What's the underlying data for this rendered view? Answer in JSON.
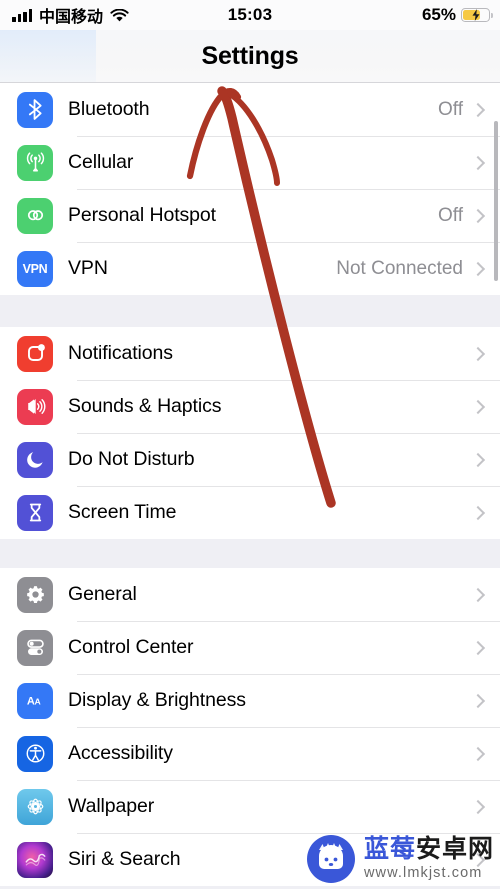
{
  "status_bar": {
    "carrier": "中国移动",
    "time": "15:03",
    "battery_percent": "65%",
    "battery_level": 65,
    "signal_icon": "cellular-signal-icon",
    "wifi_icon": "wifi-icon",
    "battery_icon": "battery-charging-icon"
  },
  "navbar": {
    "title": "Settings"
  },
  "groups": [
    {
      "id": "connectivity",
      "rows": [
        {
          "label": "Bluetooth",
          "value": "Off",
          "icon": "bluetooth-icon",
          "icon_bg": "#3478f6"
        },
        {
          "label": "Cellular",
          "value": "",
          "icon": "cellular-icon",
          "icon_bg": "#4cd070"
        },
        {
          "label": "Personal Hotspot",
          "value": "Off",
          "icon": "personal-hotspot-icon",
          "icon_bg": "#4cd070"
        },
        {
          "label": "VPN",
          "value": "Not Connected",
          "icon": "vpn-icon",
          "icon_bg": "#3478f6"
        }
      ]
    },
    {
      "id": "alerts",
      "rows": [
        {
          "label": "Notifications",
          "value": "",
          "icon": "notifications-icon",
          "icon_bg": "#f03e2f"
        },
        {
          "label": "Sounds & Haptics",
          "value": "",
          "icon": "sounds-haptics-icon",
          "icon_bg": "#ec3css"
        },
        {
          "label": "Do Not Disturb",
          "value": "",
          "icon": "do-not-disturb-icon",
          "icon_bg": "#5251d6"
        },
        {
          "label": "Screen Time",
          "value": "",
          "icon": "screen-time-icon",
          "icon_bg": "#5251d6"
        }
      ]
    },
    {
      "id": "system",
      "rows": [
        {
          "label": "General",
          "value": "",
          "icon": "general-gear-icon",
          "icon_bg": "#8e8e93"
        },
        {
          "label": "Control Center",
          "value": "",
          "icon": "control-center-icon",
          "icon_bg": "#8e8e93"
        },
        {
          "label": "Display & Brightness",
          "value": "",
          "icon": "display-brightness-icon",
          "icon_bg": "#3478f6"
        },
        {
          "label": "Accessibility",
          "value": "",
          "icon": "accessibility-icon",
          "icon_bg": "#1665e3"
        },
        {
          "label": "Wallpaper",
          "value": "",
          "icon": "wallpaper-icon",
          "icon_bg": "#45b0e3"
        },
        {
          "label": "Siri & Search",
          "value": "",
          "icon": "siri-search-icon",
          "icon_bg": "#2b1440"
        }
      ]
    }
  ],
  "annotation": {
    "type": "hand-drawn-arrow",
    "color": "#ab3524"
  },
  "watermark": {
    "brand_blue": "蓝莓",
    "brand_dark": "安卓网",
    "url": "www.lmkjst.com",
    "logo": "blueberry-android-logo"
  }
}
